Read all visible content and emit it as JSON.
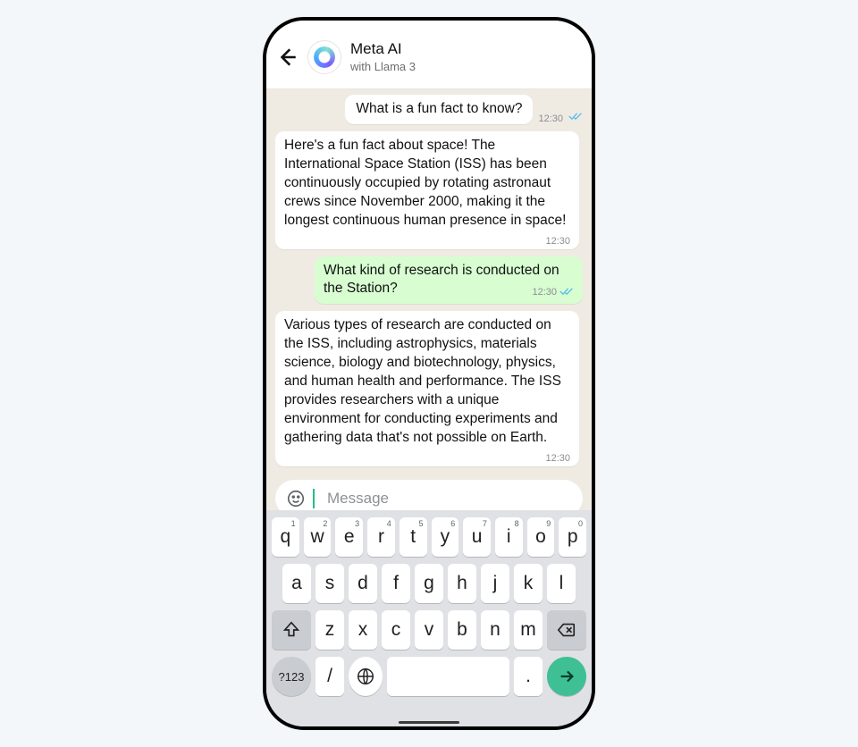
{
  "header": {
    "title": "Meta AI",
    "subtitle": "with Llama 3",
    "avatar": "meta-ai-ring"
  },
  "messages": [
    {
      "role": "user",
      "style": "first",
      "text": "What is a fun fact to know?",
      "time": "12:30",
      "read": true
    },
    {
      "role": "assistant",
      "text": "Here's a fun fact about space! The International Space Station (ISS) has been continuously occupied by rotating astronaut crews since November 2000, making it the longest continuous human presence in space!",
      "time": "12:30"
    },
    {
      "role": "user",
      "text": "What kind of research is conducted on the Station?",
      "time": "12:30",
      "read": true
    },
    {
      "role": "assistant",
      "text": "Various types of research are conducted on the ISS, including astrophysics, materials science, biology and biotechnology, physics, and human health and performance. The ISS provides researchers with a unique environment for conducting experiments and gathering data that's not possible on Earth.",
      "time": "12:30"
    }
  ],
  "composer": {
    "placeholder": "Message",
    "value": ""
  },
  "keyboard": {
    "row1": [
      {
        "k": "q",
        "n": "1"
      },
      {
        "k": "w",
        "n": "2"
      },
      {
        "k": "e",
        "n": "3"
      },
      {
        "k": "r",
        "n": "4"
      },
      {
        "k": "t",
        "n": "5"
      },
      {
        "k": "y",
        "n": "6"
      },
      {
        "k": "u",
        "n": "7"
      },
      {
        "k": "i",
        "n": "8"
      },
      {
        "k": "o",
        "n": "9"
      },
      {
        "k": "p",
        "n": "0"
      }
    ],
    "row2": [
      "a",
      "s",
      "d",
      "f",
      "g",
      "h",
      "j",
      "k",
      "l"
    ],
    "row3": [
      "z",
      "x",
      "c",
      "v",
      "b",
      "n",
      "m"
    ],
    "numKey": "?123",
    "slashKey": "/",
    "periodKey": "."
  }
}
